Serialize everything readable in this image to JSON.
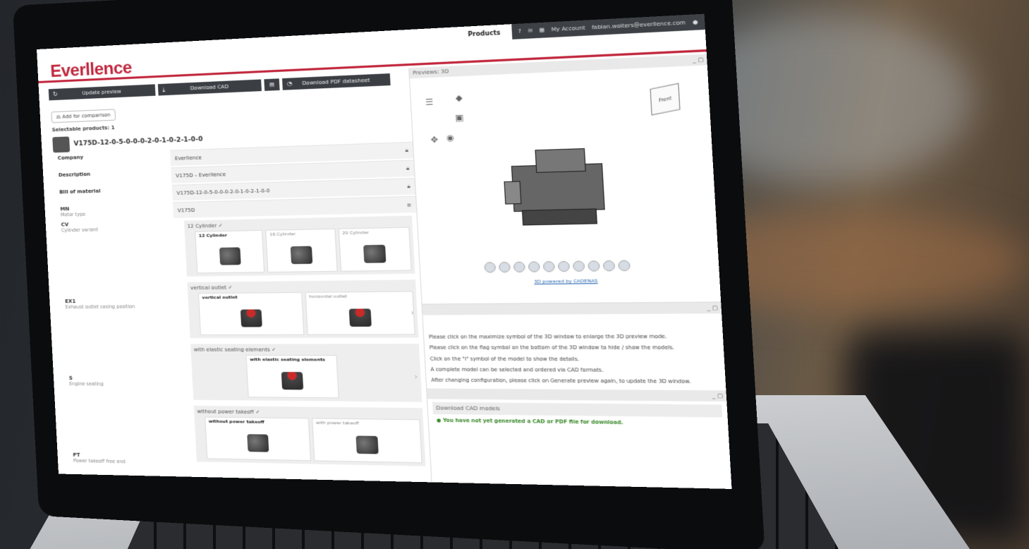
{
  "topbar": {
    "products": "Products",
    "my_account": "My Account",
    "email": "fabian.wolters@everllence.com"
  },
  "brand": {
    "logo": "Everllence",
    "accent": "#c1273d"
  },
  "toolbar": {
    "update": "Update preview",
    "download_cad": "Download CAD",
    "download_pdf": "Download PDF datasheet"
  },
  "compare": "Add for comparison",
  "selectable": "Selectable products: 1",
  "product": {
    "name": "V175D-12-0-5-0-0-0-2-0-1-0-2-1-0-0"
  },
  "labels": {
    "company": "Company",
    "description": "Description",
    "bom": "Bill of material",
    "mn_code": "MN",
    "mn_text": "Motor type",
    "cv_code": "CV",
    "cv_text": "Cylinder variant",
    "ex_code": "EX1",
    "ex_text": "Exhaust outlet casing position",
    "s_code": "S",
    "s_text": "Engine seating",
    "pt_code": "PT",
    "pt_text": "Power takeoff free end"
  },
  "tree": {
    "company": "Everllence",
    "description": "V175D – Everllence",
    "bom": "V175D-12-0-5-0-0-0-2-0-1-0-2-1-0-0",
    "motor": "V175D"
  },
  "groups": {
    "cyl": {
      "title": "12 Cylinder ✓",
      "opts": [
        "12 Cylinder",
        "16 Cylinder",
        "20 Cylinder"
      ]
    },
    "outlet": {
      "title": "vertical outlet ✓",
      "opts": [
        "vertical outlet",
        "horizontal outlet"
      ]
    },
    "seat": {
      "title": "with elastic seating elements ✓",
      "opts": [
        "with elastic seating elements"
      ]
    },
    "pto": {
      "title": "without power takeoff ✓",
      "opts": [
        "without power takeoff",
        "with power takeoff"
      ]
    }
  },
  "preview": {
    "title": "Previews: 3D",
    "cube_label": "Front",
    "powered": "3D powered by CADENAS"
  },
  "info": {
    "l1": "Please click on the maximize symbol of the 3D window to enlarge the 3D preview mode.",
    "l2": "Please click on the flag symbol on the bottom of the 3D window to hide / show the models.",
    "l3": "Click on the \"i\" symbol of the model to show the details.",
    "l4": "A complete model can be selected and ordered via CAD formats.",
    "l5": "After changing configuration, please click on Generate preview again, to update the 3D window."
  },
  "download": {
    "title": "Download CAD models",
    "msg": "You have not yet generated a CAD or PDF file for download."
  }
}
